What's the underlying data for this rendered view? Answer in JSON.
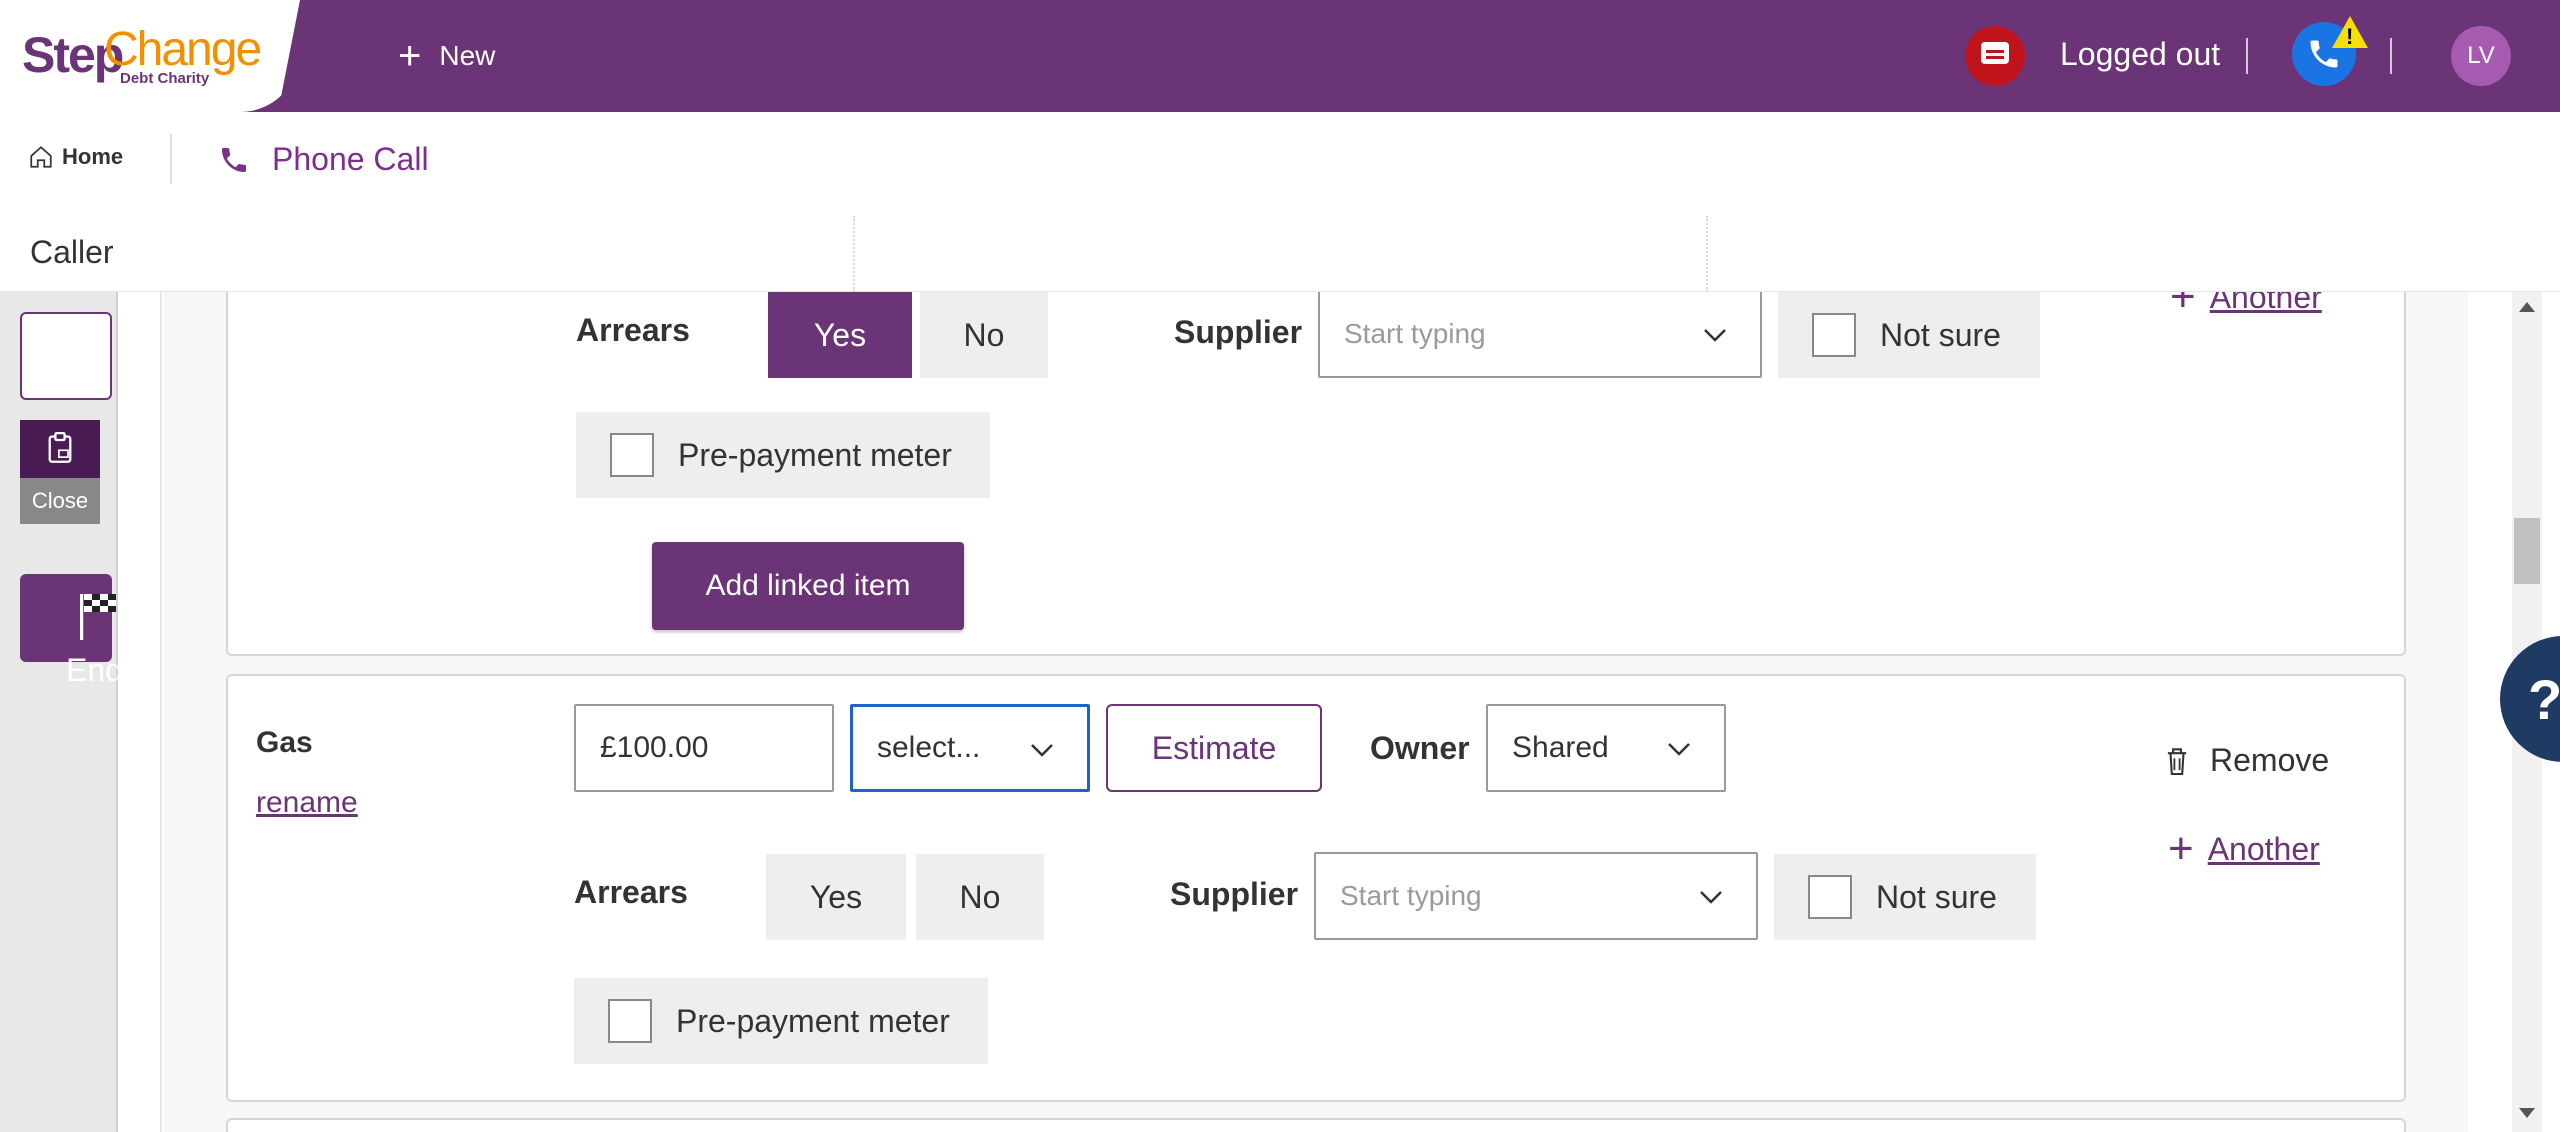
{
  "header": {
    "logo_step": "Step",
    "logo_change": "Change",
    "logo_sub": "Debt Charity",
    "new_label": "New",
    "status_label": "Logged out",
    "avatar_initials": "LV"
  },
  "nav": {
    "home_label": "Home",
    "phone_call_label": "Phone Call",
    "caller_label": "Caller"
  },
  "sidebar": {
    "close_label": "Close",
    "end_session_label": "End Session"
  },
  "first_item": {
    "arrears_label": "Arrears",
    "arrears_yes": "Yes",
    "arrears_no": "No",
    "arrears_selected": "Yes",
    "supplier_label": "Supplier",
    "supplier_placeholder": "Start typing",
    "not_sure_label": "Not sure",
    "prepayment_label": "Pre-payment meter",
    "add_linked_label": "Add linked item",
    "another_label": "Another"
  },
  "gas_item": {
    "title": "Gas",
    "rename_label": "rename",
    "amount_value": "£100.00",
    "frequency_value": "select...",
    "estimate_label": "Estimate",
    "owner_label": "Owner",
    "owner_value": "Shared",
    "remove_label": "Remove",
    "another_label": "Another",
    "arrears_label": "Arrears",
    "arrears_yes": "Yes",
    "arrears_no": "No",
    "supplier_label": "Supplier",
    "supplier_placeholder": "Start typing",
    "not_sure_label": "Not sure",
    "prepayment_label": "Pre-payment meter"
  },
  "help": {
    "label": "?"
  },
  "colors": {
    "brand_purple": "#6b3476",
    "brand_orange": "#f29100",
    "alert_red": "#c0141c",
    "phone_blue": "#1b74e4",
    "help_navy": "#1f3a63"
  }
}
